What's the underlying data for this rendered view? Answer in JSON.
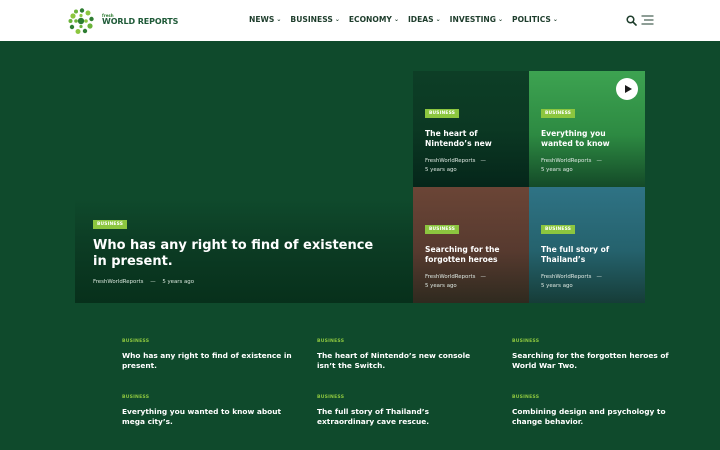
{
  "header": {
    "logo_small": "fresh",
    "logo_text": "WORLD REPORTS",
    "nav": [
      "NEWS",
      "BUSINESS",
      "ECONOMY",
      "IDEAS",
      "INVESTING",
      "POLITICS"
    ]
  },
  "hero": {
    "category": "BUSINESS",
    "title": "Who has any right to find of existence in present.",
    "author": "FreshWorldReports",
    "separator": "—",
    "time": "5 years ago"
  },
  "tiles": [
    {
      "category": "BUSINESS",
      "title": "The heart of Nintendo’s new",
      "author": "FreshWorldReports",
      "separator": "—",
      "time": "5 years ago"
    },
    {
      "category": "BUSINESS",
      "title": "Everything you wanted to know",
      "author": "FreshWorldReports",
      "separator": "—",
      "time": "5 years ago"
    },
    {
      "category": "BUSINESS",
      "title": "Searching for the forgotten heroes",
      "author": "FreshWorldReports",
      "separator": "—",
      "time": "5 years ago"
    },
    {
      "category": "BUSINESS",
      "title": "The full story of Thailand’s",
      "author": "FreshWorldReports",
      "separator": "—",
      "time": "5 years ago"
    }
  ],
  "articles": [
    {
      "category": "BUSINESS",
      "title": "Who has any right to find of existence in present."
    },
    {
      "category": "BUSINESS",
      "title": "The heart of Nintendo’s new console isn’t the Switch."
    },
    {
      "category": "BUSINESS",
      "title": "Searching for the forgotten heroes of World War Two."
    },
    {
      "category": "BUSINESS",
      "title": "Everything you wanted to know about mega city’s."
    },
    {
      "category": "BUSINESS",
      "title": "The full story of Thailand’s extraordinary cave rescue."
    },
    {
      "category": "BUSINESS",
      "title": "Combining design and psychology to change behavior."
    }
  ],
  "colors": {
    "background": "#0f4a2c",
    "accent": "#8cc63f",
    "header_bg": "#ffffff"
  }
}
